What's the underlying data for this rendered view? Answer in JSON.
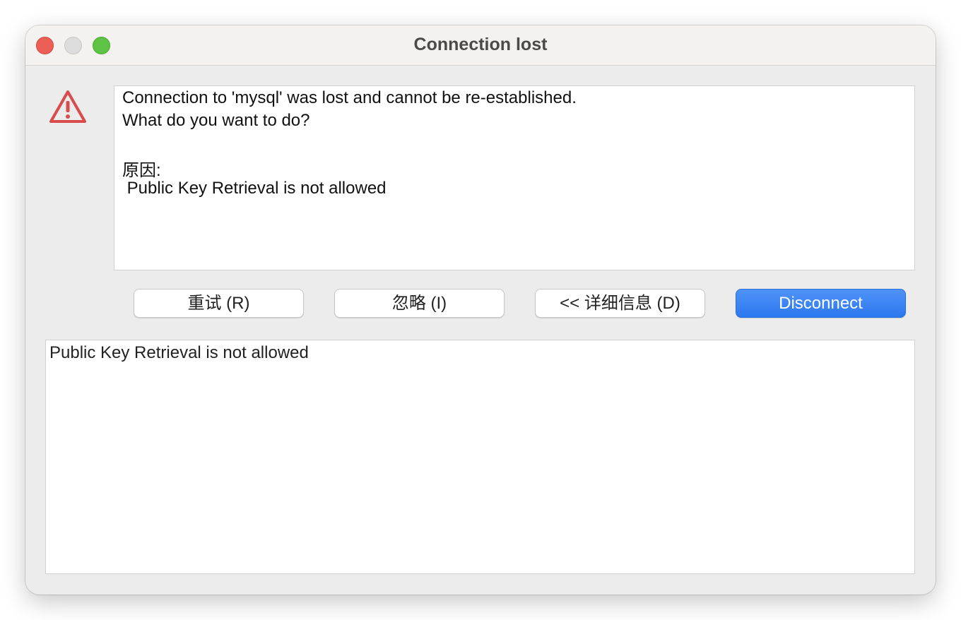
{
  "window": {
    "title": "Connection lost"
  },
  "message": {
    "lines": [
      "Connection to 'mysql' was lost and cannot be re-established.",
      "What do you want to do?",
      "",
      "原因:",
      " Public Key Retrieval is not allowed"
    ]
  },
  "buttons": {
    "retry": "重试 (R)",
    "ignore": "忽略 (I)",
    "details": "<< 详细信息 (D)",
    "disconnect": "Disconnect"
  },
  "details": {
    "text": "Public Key Retrieval is not allowed"
  },
  "icons": {
    "warning": "warning-triangle-icon"
  },
  "colors": {
    "warning": "#d94c4c",
    "primary_button": "#2f7bf0",
    "close": "#ec5f57",
    "minimize": "#dcdcdc",
    "maximize": "#5ec344"
  }
}
